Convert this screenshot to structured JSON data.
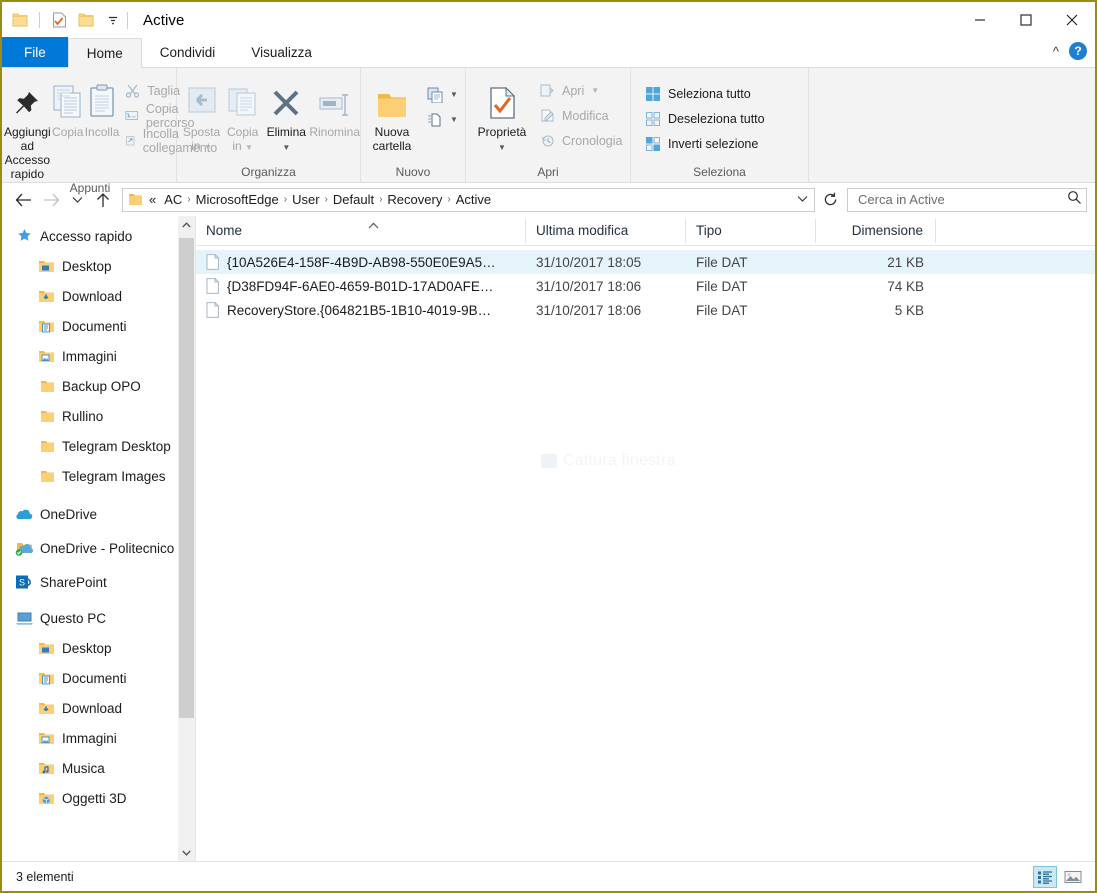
{
  "window": {
    "title": "Active",
    "quick_access": [
      "folder-icon",
      "properties-icon",
      "new-folder-icon",
      "customize-dropdown-icon"
    ],
    "caption": {
      "minimize": "—",
      "maximize": "□",
      "close": "✕"
    }
  },
  "tabs": [
    {
      "label": "File",
      "id": "file"
    },
    {
      "label": "Home",
      "id": "home"
    },
    {
      "label": "Condividi",
      "id": "condividi"
    },
    {
      "label": "Visualizza",
      "id": "visualizza"
    }
  ],
  "ribbon": {
    "collapse_icon": "chevron-up-icon",
    "help_label": "?",
    "groups": [
      {
        "label": "Appunti",
        "big": [
          {
            "label_line1": "Aggiungi ad",
            "label_line2": "Accesso rapido",
            "icon": "pin-icon",
            "enabled": true
          },
          {
            "label_line1": "Copia",
            "label_line2": "",
            "icon": "copy-icon",
            "enabled": false
          },
          {
            "label_line1": "Incolla",
            "label_line2": "",
            "icon": "paste-icon",
            "enabled": false
          }
        ],
        "small": [
          {
            "label": "Taglia",
            "icon": "scissors-icon",
            "enabled": false
          },
          {
            "label": "Copia percorso",
            "icon": "copy-path-icon",
            "enabled": false
          },
          {
            "label": "Incolla collegamento",
            "icon": "paste-shortcut-icon",
            "enabled": false
          }
        ]
      },
      {
        "label": "Organizza",
        "big": [
          {
            "label_line1": "Sposta",
            "label_line2": "in",
            "icon": "move-to-icon",
            "enabled": false,
            "dropdown": true
          },
          {
            "label_line1": "Copia",
            "label_line2": "in",
            "icon": "copy-to-icon",
            "enabled": false,
            "dropdown": true
          },
          {
            "label_line1": "Elimina",
            "label_line2": "",
            "icon": "delete-x-icon",
            "enabled": true,
            "dropdown": true
          },
          {
            "label_line1": "Rinomina",
            "label_line2": "",
            "icon": "rename-icon",
            "enabled": false
          }
        ],
        "small": []
      },
      {
        "label": "Nuovo",
        "big": [
          {
            "label_line1": "Nuova",
            "label_line2": "cartella",
            "icon": "new-folder-icon",
            "enabled": true
          }
        ],
        "small": [
          {
            "label": "",
            "icon": "new-item-icon",
            "enabled": true,
            "dropdown": true
          },
          {
            "label": "",
            "icon": "easy-access-icon",
            "enabled": true,
            "dropdown": true
          }
        ]
      },
      {
        "label": "Apri",
        "big": [
          {
            "label_line1": "Proprietà",
            "label_line2": "",
            "icon": "properties-icon",
            "enabled": true,
            "dropdown": true
          }
        ],
        "small": [
          {
            "label": "Apri",
            "icon": "open-icon",
            "enabled": false,
            "dropdown": true
          },
          {
            "label": "Modifica",
            "icon": "edit-icon",
            "enabled": false
          },
          {
            "label": "Cronologia",
            "icon": "history-icon",
            "enabled": false
          }
        ]
      },
      {
        "label": "Seleziona",
        "big": [],
        "small": [
          {
            "label": "Seleziona tutto",
            "icon": "select-all-icon",
            "enabled": true
          },
          {
            "label": "Deseleziona tutto",
            "icon": "select-none-icon",
            "enabled": true
          },
          {
            "label": "Inverti selezione",
            "icon": "invert-selection-icon",
            "enabled": true
          }
        ]
      }
    ]
  },
  "addressbar": {
    "back_icon": "arrow-left-icon",
    "forward_icon": "arrow-right-icon",
    "recent_icon": "chevron-down-icon",
    "up_icon": "arrow-up-icon",
    "overflow": "«",
    "crumbs": [
      "AC",
      "MicrosoftEdge",
      "User",
      "Default",
      "Recovery",
      "Active"
    ],
    "separator": "›",
    "dropdown_icon": "chevron-down-icon",
    "refresh_icon": "refresh-icon"
  },
  "search": {
    "placeholder": "Cerca in Active",
    "value": "",
    "icon": "search-icon"
  },
  "navpane": {
    "items": [
      {
        "label": "Accesso rapido",
        "icon": "star-pin-icon",
        "level": 0,
        "pinned": false
      },
      {
        "label": "Desktop",
        "icon": "desktop-folder-icon",
        "level": 1,
        "pinned": true
      },
      {
        "label": "Download",
        "icon": "download-folder-icon",
        "level": 1,
        "pinned": true
      },
      {
        "label": "Documenti",
        "icon": "documents-folder-icon",
        "level": 1,
        "pinned": true
      },
      {
        "label": "Immagini",
        "icon": "pictures-folder-icon",
        "level": 1,
        "pinned": true
      },
      {
        "label": "Backup OPO",
        "icon": "folder-icon",
        "level": 1,
        "pinned": false
      },
      {
        "label": "Rullino",
        "icon": "folder-icon",
        "level": 1,
        "pinned": false
      },
      {
        "label": "Telegram Desktop",
        "icon": "folder-icon",
        "level": 1,
        "pinned": false
      },
      {
        "label": "Telegram Images",
        "icon": "folder-icon",
        "level": 1,
        "pinned": false
      },
      {
        "label": "OneDrive",
        "icon": "onedrive-icon",
        "level": 0,
        "pinned": false
      },
      {
        "label": "OneDrive - Politecnico",
        "icon": "onedrive-sync-icon",
        "level": 0,
        "pinned": false
      },
      {
        "label": "SharePoint",
        "icon": "sharepoint-icon",
        "level": 0,
        "pinned": false
      },
      {
        "label": "Questo PC",
        "icon": "this-pc-icon",
        "level": 0,
        "pinned": false
      },
      {
        "label": "Desktop",
        "icon": "desktop-folder-icon",
        "level": 1,
        "pinned": false
      },
      {
        "label": "Documenti",
        "icon": "documents-folder-icon",
        "level": 1,
        "pinned": false
      },
      {
        "label": "Download",
        "icon": "download-folder-icon",
        "level": 1,
        "pinned": false
      },
      {
        "label": "Immagini",
        "icon": "pictures-folder-icon",
        "level": 1,
        "pinned": false
      },
      {
        "label": "Musica",
        "icon": "music-folder-icon",
        "level": 1,
        "pinned": false
      },
      {
        "label": "Oggetti 3D",
        "icon": "objects3d-folder-icon",
        "level": 1,
        "pinned": false
      }
    ],
    "scroll_up_icon": "chevron-up-icon",
    "scroll_down_icon": "chevron-down-icon"
  },
  "filelist": {
    "watermark": "Cattura finestra",
    "columns": [
      {
        "label": "Nome",
        "key": "name",
        "sorted": "asc"
      },
      {
        "label": "Ultima modifica",
        "key": "modified"
      },
      {
        "label": "Tipo",
        "key": "type"
      },
      {
        "label": "Dimensione",
        "key": "size"
      }
    ],
    "rows": [
      {
        "name": "{10A526E4-158F-4B9D-AB98-550E0E9A5…",
        "modified": "31/10/2017 18:05",
        "type": "File DAT",
        "size": "21 KB",
        "icon": "dat-file-icon",
        "selected": true
      },
      {
        "name": "{D38FD94F-6AE0-4659-B01D-17AD0AFE…",
        "modified": "31/10/2017 18:06",
        "type": "File DAT",
        "size": "74 KB",
        "icon": "dat-file-icon",
        "selected": false
      },
      {
        "name": "RecoveryStore.{064821B5-1B10-4019-9B…",
        "modified": "31/10/2017 18:06",
        "type": "File DAT",
        "size": "5 KB",
        "icon": "dat-file-icon",
        "selected": false
      }
    ]
  },
  "statusbar": {
    "count_text": "3 elementi",
    "views": [
      {
        "icon": "details-view-icon",
        "active": true
      },
      {
        "icon": "large-icons-view-icon",
        "active": false
      }
    ]
  },
  "colors": {
    "accent": "#0078d7",
    "selection": "#e5f3fb",
    "window_border": "#9a8b17",
    "ribbon_bg": "#f3f3f3",
    "folder_yellow": "#fcd77f"
  }
}
